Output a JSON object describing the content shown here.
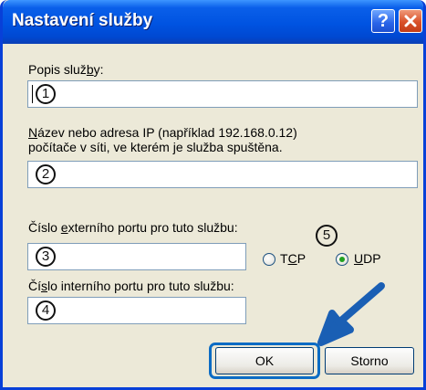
{
  "dialog": {
    "title": "Nastavení služby",
    "help_button": "?"
  },
  "fields": {
    "description_label_pre": "Popis služ",
    "description_label_u": "b",
    "description_label_post": "y:",
    "description_marker": "1",
    "host_label_line1_u": "N",
    "host_label_line1_post": "ázev nebo adresa IP (například 192.168.0.12)",
    "host_label_line2": "počítače v síti, ve kterém je služba spuštěna.",
    "host_marker": "2",
    "external_port_label_pre": "Číslo ",
    "external_port_label_u": "e",
    "external_port_label_post": "xterního portu pro tuto službu:",
    "external_port_marker": "3",
    "internal_port_label_pre": "Čí",
    "internal_port_label_u": "s",
    "internal_port_label_post": "lo interního portu pro tuto službu:",
    "internal_port_marker": "4"
  },
  "protocol": {
    "marker": "5",
    "tcp_label_pre": "T",
    "tcp_label_u": "C",
    "tcp_label_post": "P",
    "udp_label_u": "U",
    "udp_label_post": "DP",
    "selected": "UDP"
  },
  "buttons": {
    "ok": "OK",
    "cancel": "Storno"
  },
  "colors": {
    "title_bar": "#0053e1",
    "dialog_bg": "#ece9d8",
    "arrow": "#1a5fb4",
    "radio_selected": "#21a121"
  },
  "icons": {
    "close": "close-icon",
    "pointer": "arrow-pointer-icon"
  }
}
